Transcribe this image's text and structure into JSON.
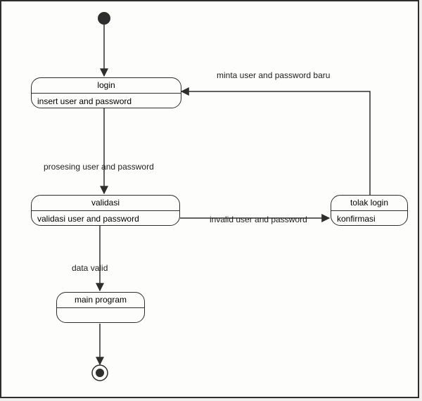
{
  "states": {
    "login": {
      "title": "login",
      "body": "insert user and password"
    },
    "validasi": {
      "title": "validasi",
      "body": "validasi user and password"
    },
    "tolak": {
      "title": "tolak login",
      "body": "konfirmasi"
    },
    "main": {
      "title": "main program",
      "body": ""
    }
  },
  "edges": {
    "processing": "prosesing user and password",
    "invalid": "invalid user and password",
    "minta": "minta user and password baru",
    "data_valid": "data valid"
  }
}
